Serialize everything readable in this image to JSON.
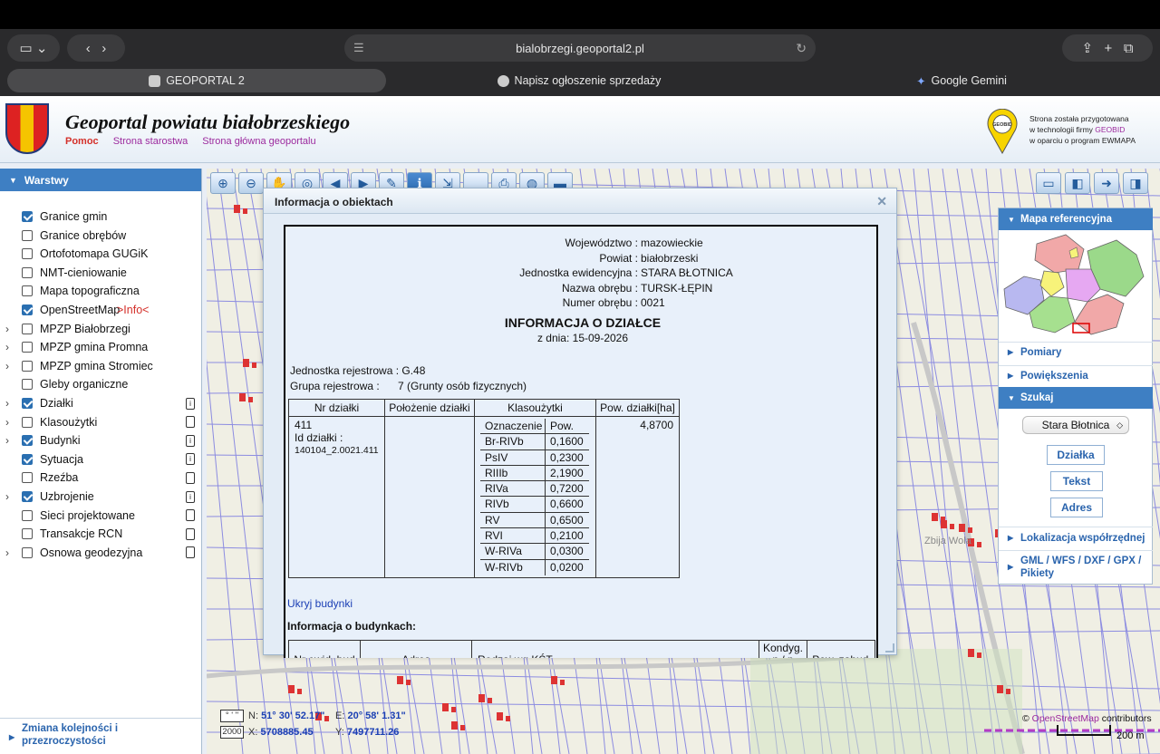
{
  "browser": {
    "url": "bialobrzegi.geoportal2.pl",
    "tabs": [
      {
        "label": "GEOPORTAL 2"
      },
      {
        "label": "Napisz ogłoszenie sprzedaży"
      },
      {
        "label": "Google Gemini"
      }
    ]
  },
  "header": {
    "title": "Geoportal powiatu białobrzeskiego",
    "links": {
      "pomoc": "Pomoc",
      "starostwo": "Strona starostwa",
      "glowna": "Strona główna geoportalu"
    },
    "geobid_logo_text": "GEOBID",
    "geobid_line1": "Strona została przygotowana",
    "geobid_line2a": "w technologii firmy ",
    "geobid_line2b": "GEOBID",
    "geobid_line3": "w oparciu o program EWMAPA"
  },
  "layers_panel": {
    "title": "Warstwy",
    "items": [
      {
        "label": "Granice gmin",
        "checked": true
      },
      {
        "label": "Granice obrębów",
        "checked": false
      },
      {
        "label": "Ortofotomapa GUGiK",
        "checked": false
      },
      {
        "label": "NMT-cieniowanie",
        "checked": false
      },
      {
        "label": "Mapa topograficzna",
        "checked": false
      },
      {
        "label": "OpenStreetMap",
        "extra": ">Info<",
        "checked": true
      },
      {
        "label": "MPZP Białobrzegi",
        "checked": false
      },
      {
        "label": "MPZP gmina Promna",
        "checked": false
      },
      {
        "label": "MPZP gmina Stromiec",
        "checked": false
      },
      {
        "label": "Gleby organiczne",
        "checked": false
      },
      {
        "label": "Działki",
        "checked": true
      },
      {
        "label": "Klasoużytki",
        "checked": false
      },
      {
        "label": "Budynki",
        "checked": true
      },
      {
        "label": "Sytuacja",
        "checked": true
      },
      {
        "label": "Rzeźba",
        "checked": false
      },
      {
        "label": "Uzbrojenie",
        "checked": true
      },
      {
        "label": "Sieci projektowane",
        "checked": false
      },
      {
        "label": "Transakcje RCN",
        "checked": false
      },
      {
        "label": "Osnowa geodezyjna",
        "checked": false
      }
    ],
    "footer": "Zmiana kolejności i przezroczystości"
  },
  "dialog": {
    "title": "Informacja o obiektach",
    "header_rows": [
      {
        "k": "Województwo :",
        "v": "mazowieckie"
      },
      {
        "k": "Powiat :",
        "v": "białobrzeski"
      },
      {
        "k": "Jednostka ewidencyjna :",
        "v": "STARA BŁOTNICA"
      },
      {
        "k": "Nazwa obrębu :",
        "v": "TURSK-ŁĘPIN"
      },
      {
        "k": "Numer obrębu :",
        "v": "0021"
      }
    ],
    "info_title": "INFORMACJA O DZIAŁCE",
    "date": "z dnia: 15-09-2026",
    "jednostka_rej": "Jednostka rejestrowa : G.48",
    "grupa_rej_label": "Grupa rejestrowa :",
    "grupa_rej_value": "7 (Grunty osób fizycznych)",
    "table_headers": [
      "Nr działki",
      "Położenie działki",
      "Klasoużytki",
      "Pow. działki[ha]"
    ],
    "parcel": {
      "nr": "411",
      "id_label": "Id działki :",
      "id": "140104_2.0021.411",
      "area": "4,8700"
    },
    "klas_header": [
      "Oznaczenie",
      "Pow."
    ],
    "klas_rows": [
      [
        "Br-RIVb",
        "0,1600"
      ],
      [
        "PsIV",
        "0,2300"
      ],
      [
        "RIIIb",
        "2,1900"
      ],
      [
        "RIVa",
        "0,7200"
      ],
      [
        "RIVb",
        "0,6600"
      ],
      [
        "RV",
        "0,6500"
      ],
      [
        "RVI",
        "0,2100"
      ],
      [
        "W-RIVa",
        "0,0300"
      ],
      [
        "W-RIVb",
        "0,0200"
      ]
    ],
    "hide_buildings": "Ukryj budynki",
    "buildings_title": "Informacja o budynkach:",
    "building_headers": [
      "Nr ewid. bud",
      "Adres",
      "Rodzaj wg KŚT",
      "Kondyg. n / p",
      "Pow. zabud."
    ]
  },
  "right_panel": {
    "ref_map": "Mapa referencyjna",
    "pomiary": "Pomiary",
    "powiekszenia": "Powiększenia",
    "szukaj": "Szukaj",
    "select_value": "Stara Błotnica",
    "btn_dzialka": "Działka",
    "btn_tekst": "Tekst",
    "btn_adres": "Adres",
    "lokalizacja": "Lokalizacja współrzędnej",
    "gml": "GML / WFS / DXF / GPX / Pikiety"
  },
  "coords": {
    "mode_deg": "° ' \"",
    "n_label": "N:",
    "n_value": "51° 30' 52.17\"",
    "e_label": "E:",
    "e_value": "20° 58' 1.31\"",
    "mode_2000": "2000",
    "x_label": "X:",
    "x_value": "5708885.45",
    "y_label": "Y:",
    "y_value": "7497711.26"
  },
  "map": {
    "place_label": "Zbija Wola",
    "attribution_prefix": "© ",
    "attribution_link": "OpenStreetMap",
    "attribution_suffix": " contributors",
    "scale": "200 m"
  }
}
